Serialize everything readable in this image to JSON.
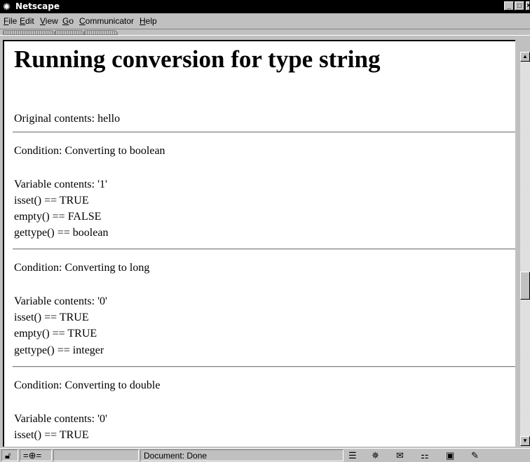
{
  "window": {
    "title": "Netscape",
    "minimize": "_",
    "maximize": "□",
    "close": "×"
  },
  "menu": {
    "items": [
      {
        "label": "File",
        "underline": "F",
        "rest": "ile"
      },
      {
        "label": "Edit",
        "underline": "E",
        "rest": "dit"
      },
      {
        "label": "View",
        "underline": "V",
        "rest": "iew"
      },
      {
        "label": "Go",
        "underline": "G",
        "rest": "o"
      },
      {
        "label": "Communicator",
        "underline": "C",
        "rest": "ommunicator"
      },
      {
        "label": "Help",
        "underline": "H",
        "rest": "elp"
      }
    ]
  },
  "page": {
    "heading": "Running conversion for type string",
    "original": "Original contents: hello",
    "blocks": [
      {
        "condition": "Condition: Converting to boolean",
        "contents": "Variable contents: '1'",
        "isset": "isset() == TRUE",
        "empty": "empty() == FALSE",
        "gettype": "gettype() == boolean"
      },
      {
        "condition": "Condition: Converting to long",
        "contents": "Variable contents: '0'",
        "isset": "isset() == TRUE",
        "empty": "empty() == TRUE",
        "gettype": "gettype() == integer"
      },
      {
        "condition": "Condition: Converting to double",
        "contents": "Variable contents: '0'",
        "isset": "isset() == TRUE"
      }
    ]
  },
  "status": {
    "text": "Document: Done"
  },
  "icons": {
    "app": "netscape-icon",
    "status": [
      "security-lock-icon",
      "connection-icon",
      "component-bar-icon",
      "navigator-icon",
      "mail-icon",
      "discussions-icon",
      "composer-icon",
      "edit-icon"
    ]
  }
}
